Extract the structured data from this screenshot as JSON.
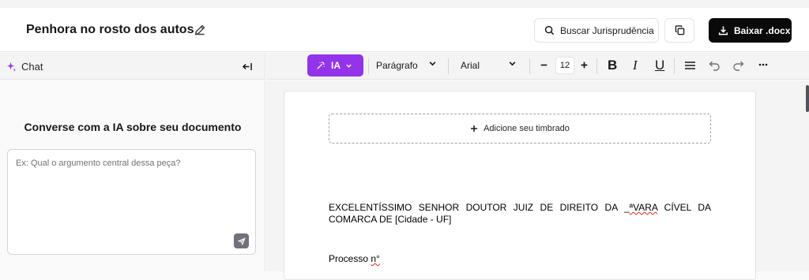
{
  "header": {
    "title": "Penhora no rosto dos autos",
    "search_label": "Buscar Jurisprudência",
    "download_label": "Baixar .docx"
  },
  "sidebar": {
    "tab_label": "Chat",
    "heading": "Converse com a IA sobre seu documento",
    "chat_placeholder": "Ex: Qual o argumento central dessa peça?"
  },
  "toolbar": {
    "ia_label": "IA",
    "style_value": "Parágrafo",
    "font_value": "Arial",
    "font_size": "12"
  },
  "editor": {
    "letterhead_label": "Adicione seu timbrado",
    "paragraph1_a": "EXCELENTÍSSIMO SENHOR DOUTOR JUIZ DE DIREITO DA _",
    "paragraph1_spell": "ªVARA",
    "paragraph1_b": " CÍVEL DA COMARCA DE [Cidade - UF]",
    "paragraph2_a": "Processo ",
    "paragraph2_spell": "n°"
  },
  "colors": {
    "accent": "#9333ea",
    "primary_button": "#0a0a0a"
  }
}
